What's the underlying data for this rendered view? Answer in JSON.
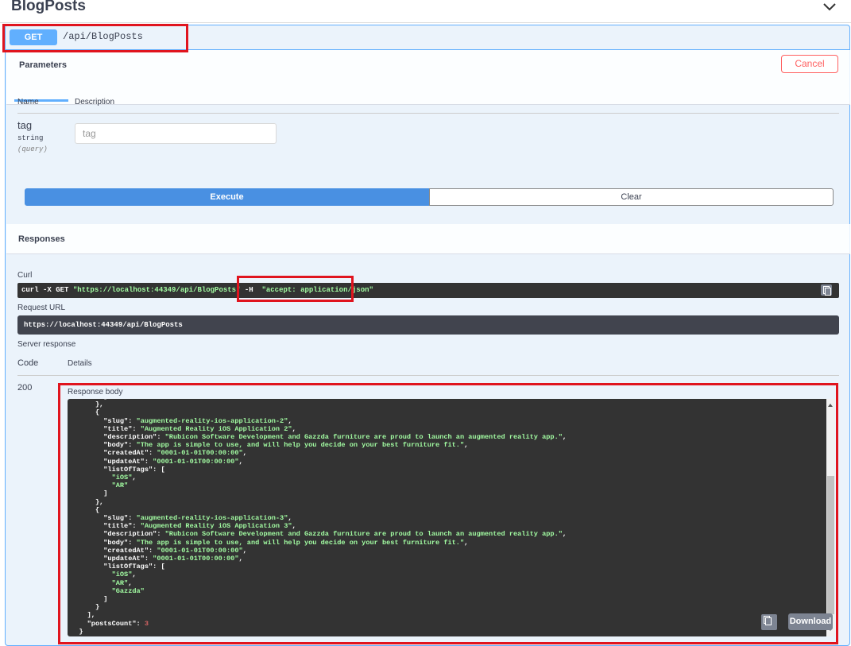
{
  "section": {
    "title": "BlogPosts"
  },
  "operation": {
    "method": "GET",
    "path": "/api/BlogPosts"
  },
  "parameters": {
    "tab_label": "Parameters",
    "cancel_label": "Cancel",
    "col_name": "Name",
    "col_description": "Description",
    "param": {
      "name": "tag",
      "type": "string",
      "in": "(query)",
      "placeholder": "tag",
      "value": ""
    }
  },
  "actions": {
    "execute_label": "Execute",
    "clear_label": "Clear"
  },
  "responses": {
    "title": "Responses",
    "curl_label": "Curl",
    "curl": {
      "cmd": "curl -X GET ",
      "url": "\"https://localhost:44349/api/BlogPosts\"",
      "flag": " -H  ",
      "header": "\"accept: application/json\""
    },
    "request_url_label": "Request URL",
    "request_url": "https://localhost:44349/api/BlogPosts",
    "server_response_label": "Server response",
    "col_code": "Code",
    "col_details": "Details",
    "code": "200",
    "body_label": "Response body",
    "download_label": "Download",
    "body_lines": [
      [
        [
          "p",
          "        ]"
        ]
      ],
      [
        [
          "p",
          "      },"
        ]
      ],
      [
        [
          "p",
          "      {"
        ]
      ],
      [
        [
          "p",
          "        "
        ],
        [
          "k",
          "\"slug\""
        ],
        [
          "p",
          ": "
        ],
        [
          "s",
          "\"augmented-reality-ios-application-2\""
        ],
        [
          "p",
          ","
        ]
      ],
      [
        [
          "p",
          "        "
        ],
        [
          "k",
          "\"title\""
        ],
        [
          "p",
          ": "
        ],
        [
          "s",
          "\"Augmented Reality iOS Application 2\""
        ],
        [
          "p",
          ","
        ]
      ],
      [
        [
          "p",
          "        "
        ],
        [
          "k",
          "\"description\""
        ],
        [
          "p",
          ": "
        ],
        [
          "s",
          "\"Rubicon Software Development and Gazzda furniture are proud to launch an augmented reality app.\""
        ],
        [
          "p",
          ","
        ]
      ],
      [
        [
          "p",
          "        "
        ],
        [
          "k",
          "\"body\""
        ],
        [
          "p",
          ": "
        ],
        [
          "s",
          "\"The app is simple to use, and will help you decide on your best furniture fit.\""
        ],
        [
          "p",
          ","
        ]
      ],
      [
        [
          "p",
          "        "
        ],
        [
          "k",
          "\"createdAt\""
        ],
        [
          "p",
          ": "
        ],
        [
          "s",
          "\"0001-01-01T00:00:00\""
        ],
        [
          "p",
          ","
        ]
      ],
      [
        [
          "p",
          "        "
        ],
        [
          "k",
          "\"updateAt\""
        ],
        [
          "p",
          ": "
        ],
        [
          "s",
          "\"0001-01-01T00:00:00\""
        ],
        [
          "p",
          ","
        ]
      ],
      [
        [
          "p",
          "        "
        ],
        [
          "k",
          "\"listOfTags\""
        ],
        [
          "p",
          ": ["
        ]
      ],
      [
        [
          "p",
          "          "
        ],
        [
          "s",
          "\"iOS\""
        ],
        [
          "p",
          ","
        ]
      ],
      [
        [
          "p",
          "          "
        ],
        [
          "s",
          "\"AR\""
        ]
      ],
      [
        [
          "p",
          "        ]"
        ]
      ],
      [
        [
          "p",
          "      },"
        ]
      ],
      [
        [
          "p",
          "      {"
        ]
      ],
      [
        [
          "p",
          "        "
        ],
        [
          "k",
          "\"slug\""
        ],
        [
          "p",
          ": "
        ],
        [
          "s",
          "\"augmented-reality-ios-application-3\""
        ],
        [
          "p",
          ","
        ]
      ],
      [
        [
          "p",
          "        "
        ],
        [
          "k",
          "\"title\""
        ],
        [
          "p",
          ": "
        ],
        [
          "s",
          "\"Augmented Reality iOS Application 3\""
        ],
        [
          "p",
          ","
        ]
      ],
      [
        [
          "p",
          "        "
        ],
        [
          "k",
          "\"description\""
        ],
        [
          "p",
          ": "
        ],
        [
          "s",
          "\"Rubicon Software Development and Gazzda furniture are proud to launch an augmented reality app.\""
        ],
        [
          "p",
          ","
        ]
      ],
      [
        [
          "p",
          "        "
        ],
        [
          "k",
          "\"body\""
        ],
        [
          "p",
          ": "
        ],
        [
          "s",
          "\"The app is simple to use, and will help you decide on your best furniture fit.\""
        ],
        [
          "p",
          ","
        ]
      ],
      [
        [
          "p",
          "        "
        ],
        [
          "k",
          "\"createdAt\""
        ],
        [
          "p",
          ": "
        ],
        [
          "s",
          "\"0001-01-01T00:00:00\""
        ],
        [
          "p",
          ","
        ]
      ],
      [
        [
          "p",
          "        "
        ],
        [
          "k",
          "\"updateAt\""
        ],
        [
          "p",
          ": "
        ],
        [
          "s",
          "\"0001-01-01T00:00:00\""
        ],
        [
          "p",
          ","
        ]
      ],
      [
        [
          "p",
          "        "
        ],
        [
          "k",
          "\"listOfTags\""
        ],
        [
          "p",
          ": ["
        ]
      ],
      [
        [
          "p",
          "          "
        ],
        [
          "s",
          "\"iOS\""
        ],
        [
          "p",
          ","
        ]
      ],
      [
        [
          "p",
          "          "
        ],
        [
          "s",
          "\"AR\""
        ],
        [
          "p",
          ","
        ]
      ],
      [
        [
          "p",
          "          "
        ],
        [
          "s",
          "\"Gazzda\""
        ]
      ],
      [
        [
          "p",
          "        ]"
        ]
      ],
      [
        [
          "p",
          "      }"
        ]
      ],
      [
        [
          "p",
          "    ],"
        ]
      ],
      [
        [
          "p",
          "    "
        ],
        [
          "k",
          "\"postsCount\""
        ],
        [
          "p",
          ": "
        ],
        [
          "n",
          "3"
        ]
      ],
      [
        [
          "p",
          "  }"
        ]
      ]
    ]
  }
}
